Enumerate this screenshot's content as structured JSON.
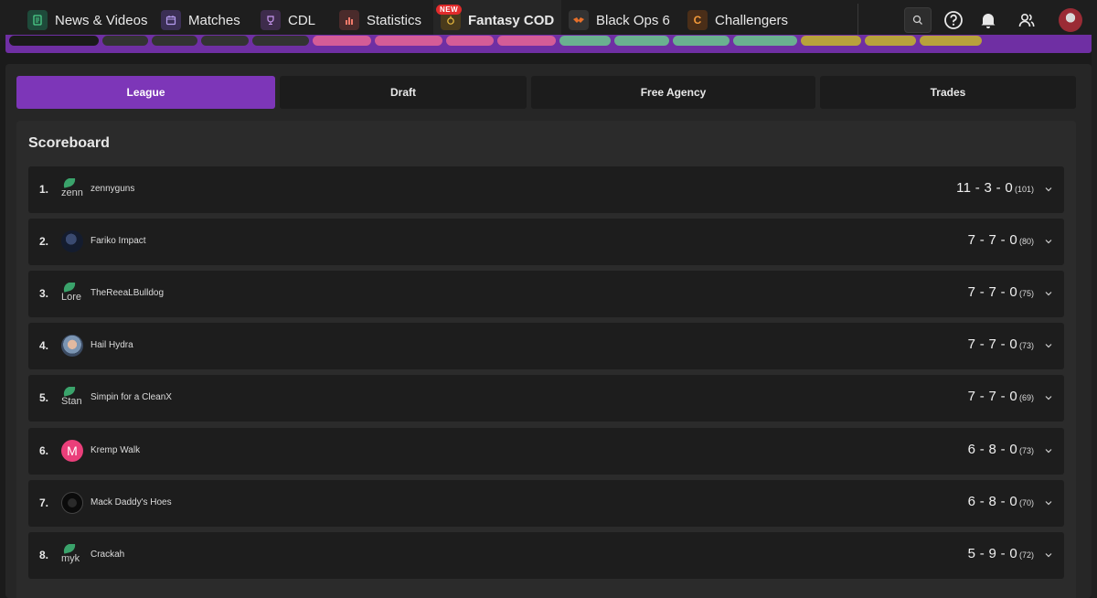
{
  "nav": {
    "items": [
      {
        "label": "News & Videos",
        "icon": "news-icon"
      },
      {
        "label": "Matches",
        "icon": "calendar-icon"
      },
      {
        "label": "CDL",
        "icon": "trophy-icon"
      },
      {
        "label": "Statistics",
        "icon": "bar-chart-icon"
      },
      {
        "label": "Fantasy COD",
        "icon": "fantasy-icon",
        "badge": "NEW"
      },
      {
        "label": "Black Ops 6",
        "icon": "black-ops-icon"
      },
      {
        "label": "Challengers",
        "icon": "challengers-icon",
        "icon_text": "C"
      }
    ]
  },
  "tabs": [
    {
      "label": "League"
    },
    {
      "label": "Draft"
    },
    {
      "label": "Free Agency"
    },
    {
      "label": "Trades"
    }
  ],
  "scoreboard": {
    "title": "Scoreboard",
    "rows": [
      {
        "rank": "1.",
        "name": "zennyguns",
        "avatar_alt": "zenn",
        "record": "11 - 3 - 0",
        "points": "(101)"
      },
      {
        "rank": "2.",
        "name": "Fariko Impact",
        "record": "7 - 7 - 0",
        "points": "(80)"
      },
      {
        "rank": "3.",
        "name": "TheReeaLBulldog",
        "avatar_alt": "Lore",
        "record": "7 - 7 - 0",
        "points": "(75)"
      },
      {
        "rank": "4.",
        "name": "Hail Hydra",
        "record": "7 - 7 - 0",
        "points": "(73)"
      },
      {
        "rank": "5.",
        "name": "Simpin for a CleanX",
        "avatar_alt": "Stan",
        "record": "7 - 7 - 0",
        "points": "(69)"
      },
      {
        "rank": "6.",
        "name": "Kremp Walk",
        "avatar_letter": "M",
        "record": "6 - 8 - 0",
        "points": "(73)"
      },
      {
        "rank": "7.",
        "name": "Mack Daddy's Hoes",
        "record": "6 - 8 - 0",
        "points": "(70)"
      },
      {
        "rank": "8.",
        "name": "Crackah",
        "avatar_alt": "myk",
        "record": "5 - 9 - 0",
        "points": "(72)"
      }
    ]
  },
  "colors": {
    "accent": "#7d36b8",
    "strip": "#6f2fa3",
    "row_bg": "#1d1d1d",
    "panel_bg": "#262626"
  }
}
